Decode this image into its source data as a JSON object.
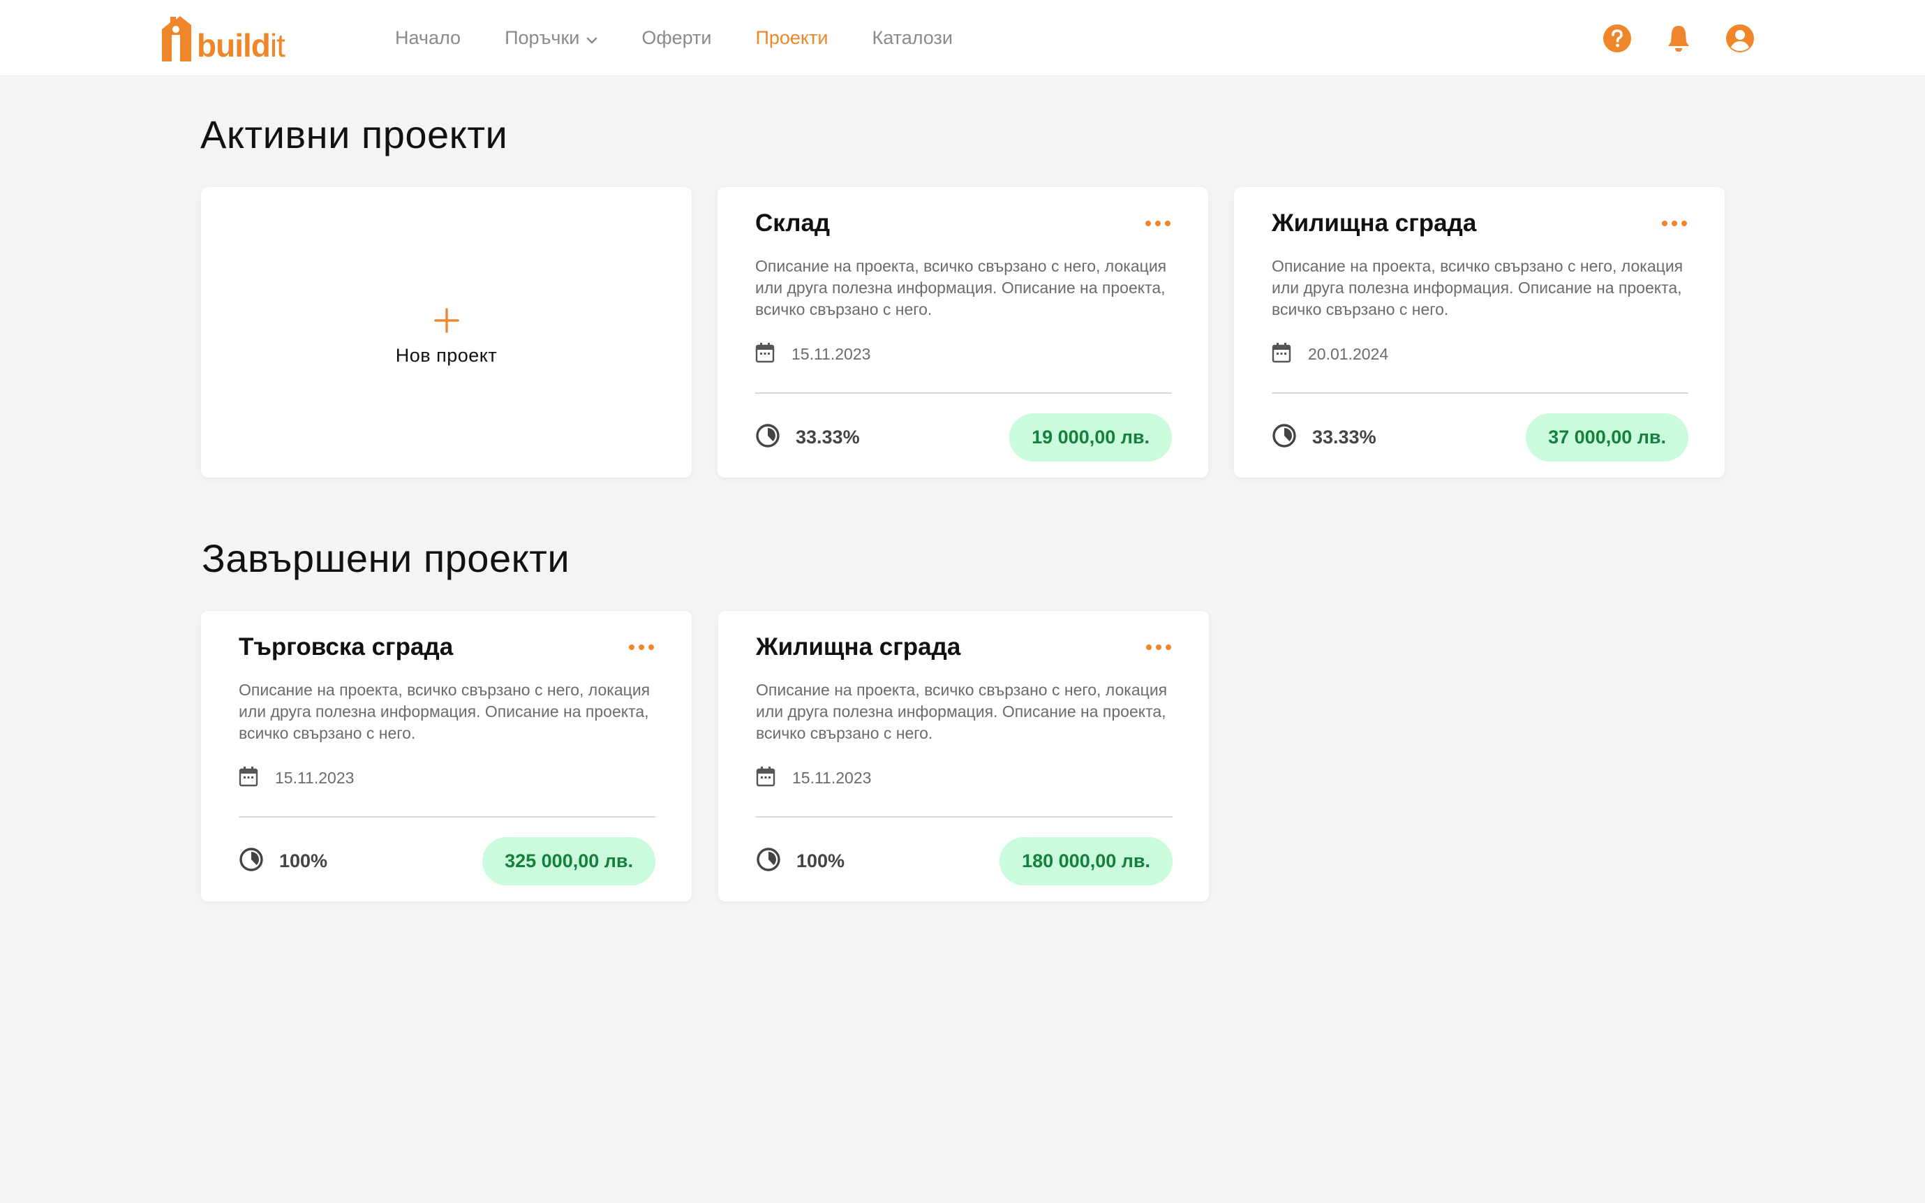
{
  "header": {
    "logo_text_main": "build",
    "logo_text_accent": "it",
    "nav": [
      {
        "label": "Начало"
      },
      {
        "label": "Поръчки"
      },
      {
        "label": "Оферти"
      },
      {
        "label": "Проекти"
      },
      {
        "label": "Каталози"
      }
    ],
    "active_nav": "Проекти"
  },
  "active_section": {
    "title": "Активни проекти",
    "new_project_label": "Нов проект",
    "projects": [
      {
        "title": "Склад",
        "description": "Описание на проекта, всичко свързано с него, локация или друга полезна информация. Описание на проекта, всичко свързано с него.",
        "date": "15.11.2023",
        "progress": "33.33%",
        "price": "19 000,00 лв."
      },
      {
        "title": "Жилищна сграда",
        "description": "Описание на проекта, всичко свързано с него, локация или друга полезна информация. Описание на проекта, всичко свързано с него.",
        "date": "20.01.2024",
        "progress": "33.33%",
        "price": "37 000,00 лв."
      }
    ]
  },
  "completed_section": {
    "title": "Завършени проекти",
    "projects": [
      {
        "title": "Търговска сграда",
        "description": "Описание на проекта, всичко свързано с него, локация или друга полезна информация. Описание на проекта, всичко свързано с него.",
        "date": "15.11.2023",
        "progress": "100%",
        "price": "325 000,00 лв."
      },
      {
        "title": "Жилищна сграда",
        "description": "Описание на проекта, всичко свързано с него, локация или друга полезна информация. Описание на проекта, всичко свързано с него.",
        "date": "15.11.2023",
        "progress": "100%",
        "price": "180 000,00 лв."
      }
    ]
  },
  "colors": {
    "accent": "#f0862a",
    "badge_bg": "#c9fbdc",
    "badge_text": "#15803d",
    "page_bg": "#f4f4f6"
  },
  "icons": {
    "help": "help-icon",
    "bell": "bell-icon",
    "user": "user-icon",
    "more": "more-dots-icon",
    "calendar": "calendar-icon",
    "progress": "progress-pie-icon"
  }
}
